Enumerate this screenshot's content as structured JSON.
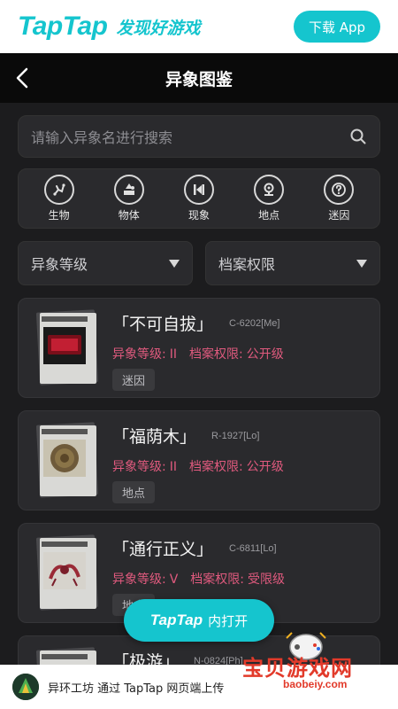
{
  "brand": {
    "logo": "TapTap",
    "slogan": "发现好游戏",
    "download": "下载 App"
  },
  "header": {
    "title": "异象图鉴"
  },
  "search": {
    "placeholder": "请输入异象名进行搜索"
  },
  "categories": [
    {
      "label": "生物",
      "icon": "creature-icon"
    },
    {
      "label": "物体",
      "icon": "object-icon"
    },
    {
      "label": "现象",
      "icon": "phenomenon-icon"
    },
    {
      "label": "地点",
      "icon": "location-icon"
    },
    {
      "label": "迷因",
      "icon": "meme-icon"
    }
  ],
  "filters": {
    "level": "异象等级",
    "access": "档案权限"
  },
  "cards": [
    {
      "title": "「不可自拔」",
      "code": "C-6202[Me]",
      "level_label": "异象等级:",
      "level": "II",
      "access_label": "档案权限:",
      "access": "公开级",
      "tag": "迷因"
    },
    {
      "title": "「福荫木」",
      "code": "R-1927[Lo]",
      "level_label": "异象等级:",
      "level": "II",
      "access_label": "档案权限:",
      "access": "公开级",
      "tag": "地点"
    },
    {
      "title": "「通行正义」",
      "code": "C-6811[Lo]",
      "level_label": "异象等级:",
      "level": "V",
      "access_label": "档案权限:",
      "access": "受限级",
      "tag": "地点"
    },
    {
      "title": "「极游」",
      "code": "N-0824[Ph]"
    }
  ],
  "open_button": {
    "brand": "TapTap",
    "label": "内打开"
  },
  "footer": {
    "text": "异环工坊 通过 TapTap 网页端上传"
  },
  "watermark": {
    "name": "宝贝游戏网",
    "url": "baobeiy.com"
  },
  "colors": {
    "accent": "#15c5ce",
    "info": "#e05a7e",
    "background": "#1c1c1e"
  }
}
